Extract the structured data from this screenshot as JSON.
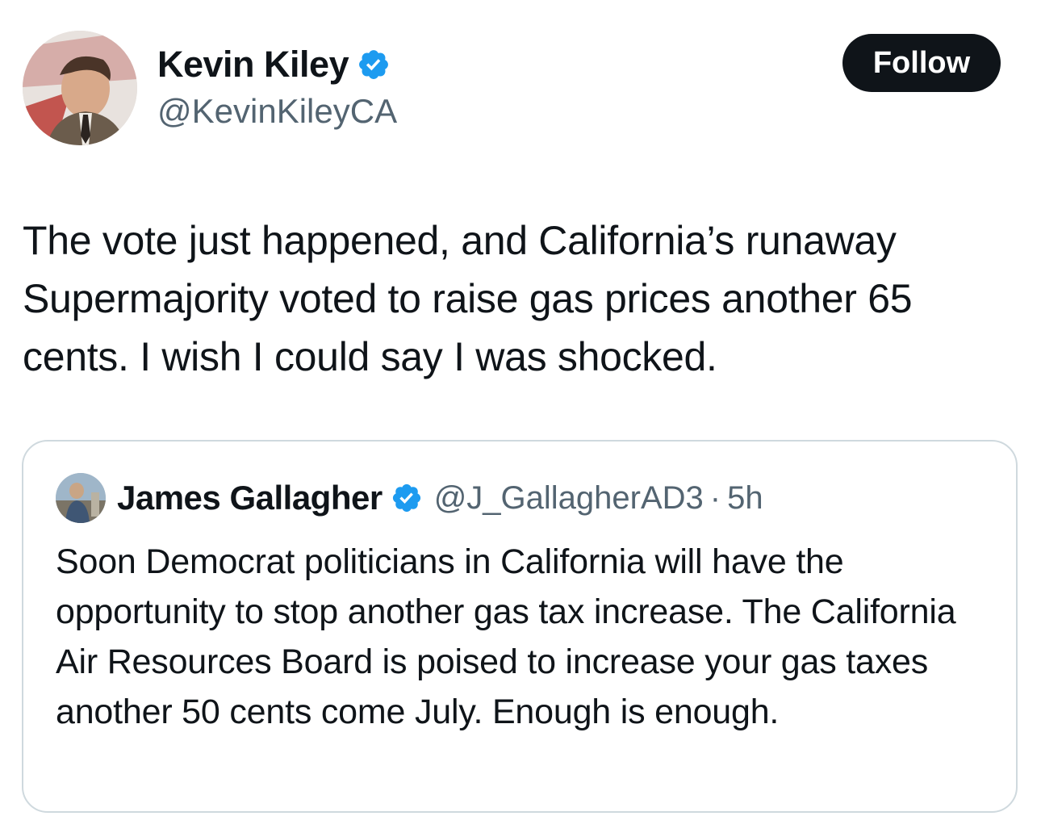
{
  "author": {
    "name": "Kevin Kiley",
    "handle": "@KevinKileyCA",
    "verified": true,
    "avatar_icon": "profile-photo"
  },
  "follow_button": {
    "label": "Follow"
  },
  "tweet": {
    "text": "The vote just happened, and California’s runaway Supermajority voted to raise gas prices another 65 cents. I wish I could say I was shocked."
  },
  "quote": {
    "author_name": "James Gallagher",
    "handle": "@J_GallagherAD3",
    "separator": "·",
    "time": "5h",
    "verified": true,
    "text": "Soon Democrat politicians in California will have the opportunity to stop another gas tax increase. The California Air Resources Board is poised to increase your gas taxes another 50 cents come July. Enough is enough."
  },
  "colors": {
    "verified_badge": "#1d9bf0",
    "follow_button_bg": "#0f1419",
    "secondary_text": "#536471",
    "card_border": "#cfd9de"
  }
}
